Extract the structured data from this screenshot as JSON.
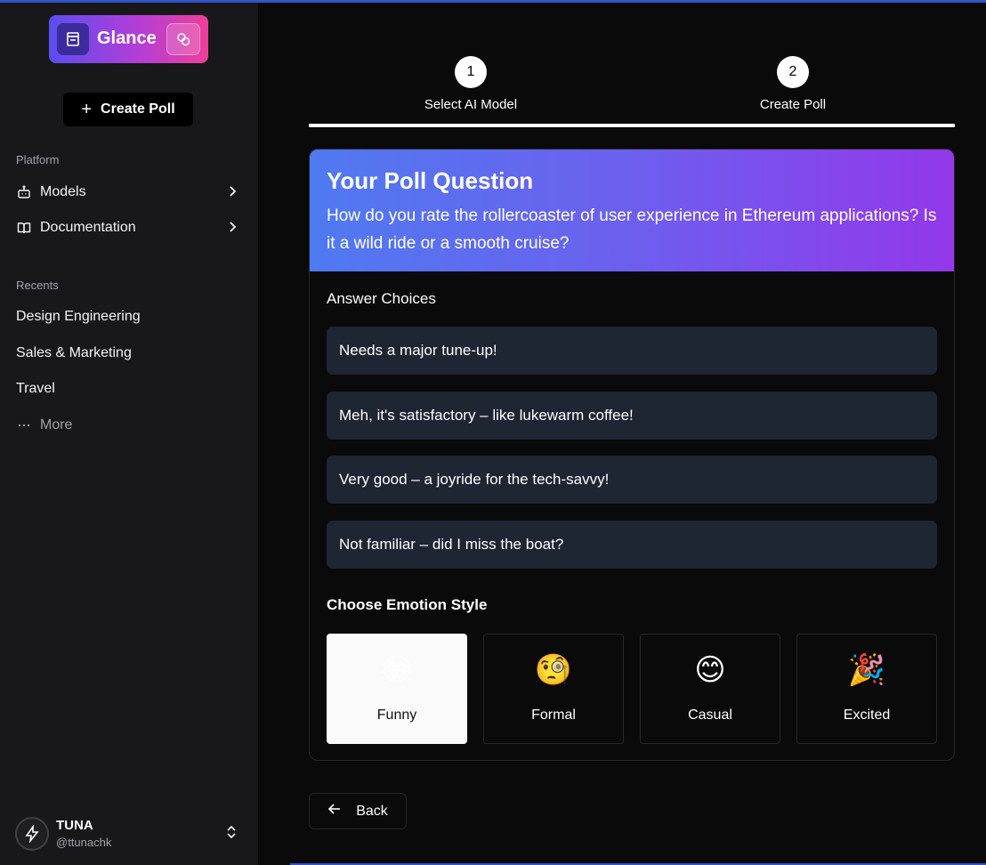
{
  "app": {
    "name": "Glance"
  },
  "sidebar": {
    "create_label": "Create Poll",
    "platform_label": "Platform",
    "platform_items": [
      {
        "label": "Models",
        "icon": "bot-icon"
      },
      {
        "label": "Documentation",
        "icon": "book-icon"
      }
    ],
    "recents_label": "Recents",
    "recents": [
      "Design Engineering",
      "Sales & Marketing",
      "Travel"
    ],
    "more_label": "More",
    "user": {
      "name": "TUNA",
      "handle": "@ttunachk"
    }
  },
  "steps": [
    {
      "number": "1",
      "label": "Select AI Model"
    },
    {
      "number": "2",
      "label": "Create Poll"
    }
  ],
  "poll": {
    "title": "Your Poll Question",
    "question": "How do you rate the rollercoaster of user experience in Ethereum applications? Is it a wild ride or a smooth cruise?",
    "answers_label": "Answer Choices",
    "answers": [
      "Needs a major tune-up!",
      "Meh, it's satisfactory – like lukewarm coffee!",
      "Very good – a joyride for the tech-savvy!",
      "Not familiar – did I miss the boat?"
    ],
    "emotion_label": "Choose Emotion Style",
    "emotions": [
      {
        "glyph": "😂",
        "label": "Funny",
        "selected": true
      },
      {
        "glyph": "🧐",
        "label": "Formal",
        "selected": false
      },
      {
        "glyph": "😊",
        "label": "Casual",
        "selected": false
      },
      {
        "glyph": "🎉",
        "label": "Excited",
        "selected": false
      }
    ]
  },
  "back_label": "Back",
  "colors": {
    "accent_blue": "#2f55c8",
    "header_gradient_start": "#4f7af0",
    "header_gradient_end": "#9338ea",
    "answer_bg": "#1e2533"
  }
}
